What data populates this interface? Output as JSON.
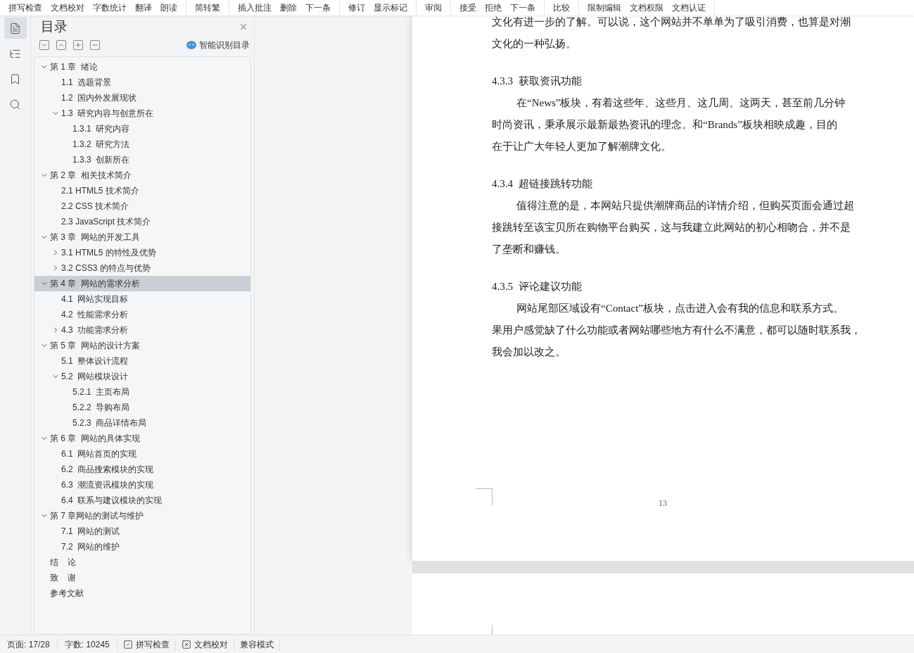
{
  "toolbar": {
    "groups": [
      [
        "拼写检查",
        "文档校对",
        "字数统计",
        "翻译",
        "朗读"
      ],
      [
        "简转繁"
      ],
      [
        "插入批注",
        "删除",
        "下一条"
      ],
      [
        "修订",
        "显示标记"
      ],
      [
        "审阅"
      ],
      [
        "接受",
        "拒绝",
        "下一条"
      ],
      [
        "比较"
      ],
      [
        "限制编辑",
        "文档权限",
        "文档认证"
      ]
    ]
  },
  "rail": [
    {
      "kind": "toc",
      "selected": true
    },
    {
      "kind": "outline",
      "selected": false
    },
    {
      "kind": "bookmark",
      "selected": false
    },
    {
      "kind": "search",
      "selected": false
    }
  ],
  "toc_panel": {
    "title": "目录",
    "tools": [
      {
        "kind": "collapse"
      },
      {
        "kind": "expand"
      },
      {
        "kind": "add"
      },
      {
        "kind": "remove"
      }
    ],
    "smart_button": "智能识别目录",
    "items": [
      {
        "label": "第 1 章  绪论",
        "selected": false,
        "expanded": true,
        "children": [
          {
            "label": "1.1  选题背景",
            "selected": false
          },
          {
            "label": "1.2  国内外发展现状",
            "selected": false
          },
          {
            "label": "1.3  研究内容与创意所在",
            "selected": false,
            "expanded": true,
            "children": [
              {
                "label": "1.3.1  研究内容",
                "selected": false
              },
              {
                "label": "1.3.2  研究方法",
                "selected": false
              },
              {
                "label": "1.3.3  创新所在",
                "selected": false
              }
            ]
          }
        ]
      },
      {
        "label": "第 2 章  相关技术简介",
        "selected": false,
        "expanded": true,
        "children": [
          {
            "label": "2.1 HTML5 技术简介",
            "selected": false
          },
          {
            "label": "2.2 CSS 技术简介",
            "selected": false
          },
          {
            "label": "2.3 JavaScript 技术简介",
            "selected": false
          }
        ]
      },
      {
        "label": "第 3 章  网站的开发工具",
        "selected": false,
        "expanded": true,
        "children": [
          {
            "label": "3.1 HTML5 的特性及优势",
            "selected": false,
            "expanded": false
          },
          {
            "label": "3.2 CSS3 的特点与优势",
            "selected": false,
            "expanded": false
          }
        ]
      },
      {
        "label": "第 4 章  网站的需求分析",
        "selected": true,
        "expanded": true,
        "children": [
          {
            "label": "4.1  网站实现目标",
            "selected": false
          },
          {
            "label": "4.2  性能需求分析",
            "selected": false
          },
          {
            "label": "4.3  功能需求分析",
            "selected": false,
            "expanded": false
          }
        ]
      },
      {
        "label": "第 5 章  网站的设计方案",
        "selected": false,
        "expanded": true,
        "children": [
          {
            "label": "5.1  整体设计流程",
            "selected": false
          },
          {
            "label": "5.2  网站模块设计",
            "selected": false,
            "expanded": true,
            "children": [
              {
                "label": "5.2.1  主页布局",
                "selected": false
              },
              {
                "label": "5.2.2  导购布局",
                "selected": false
              },
              {
                "label": "5.2.3  商品详情布局",
                "selected": false
              }
            ]
          }
        ]
      },
      {
        "label": "第 6 章  网站的具体实现",
        "selected": false,
        "expanded": true,
        "children": [
          {
            "label": "6.1  网站首页的实现",
            "selected": false
          },
          {
            "label": "6.2  商品搜索模块的实现",
            "selected": false
          },
          {
            "label": "6.3  潮流资讯模块的实现",
            "selected": false
          },
          {
            "label": "6.4  联系与建议模块的实现",
            "selected": false
          }
        ]
      },
      {
        "label": "第 7 章网站的测试与维护",
        "selected": false,
        "expanded": true,
        "children": [
          {
            "label": "7.1  网站的测试",
            "selected": false
          },
          {
            "label": "7.2  网站的维护",
            "selected": false
          }
        ]
      },
      {
        "label": "结    论",
        "selected": false
      },
      {
        "label": "致    谢",
        "selected": false
      },
      {
        "label": "参考文献",
        "selected": false
      }
    ]
  },
  "document": {
    "blocks": [
      {
        "kind": "para",
        "lines": [
          "文化有进一步的了解。可以说，这个网站并不单单为了吸引消费，也算是对潮",
          "文化的一种弘扬。"
        ]
      },
      {
        "kind": "heading",
        "text": "4.3.3  获取资讯功能"
      },
      {
        "kind": "para",
        "lines": [
          "在“News”板块，有着这些年、这些月、这几周、这两天，甚至前几分钟",
          "时尚资讯，秉承展示最新最热资讯的理念。和“Brands”板块相映成趣，目的",
          "在于让广大年轻人更加了解潮牌文化。"
        ]
      },
      {
        "kind": "heading",
        "text": "4.3.4  超链接跳转功能"
      },
      {
        "kind": "para",
        "lines": [
          "值得注意的是，本网站只提供潮牌商品的详情介绍，但购买页面会通过超",
          "接跳转至该宝贝所在购物平台购买，这与我建立此网站的初心相吻合，并不是",
          "了垄断和赚钱。"
        ]
      },
      {
        "kind": "heading",
        "text": "4.3.5  评论建议功能"
      },
      {
        "kind": "para",
        "lines": [
          "网站尾部区域设有“Contact”板块，点击进入会有我的信息和联系方式。",
          "果用户感觉缺了什么功能或者网站哪些地方有什么不满意，都可以随时联系我，",
          "我会加以改之。"
        ]
      }
    ],
    "page_number": "13"
  },
  "status_bar": {
    "page": "页面: 17/28",
    "words": "字数: 10245",
    "items": [
      {
        "kind": "check",
        "label": "拼写检查"
      },
      {
        "kind": "cross",
        "label": "文档校对"
      },
      {
        "kind": "plain",
        "label": "兼容模式"
      }
    ]
  }
}
